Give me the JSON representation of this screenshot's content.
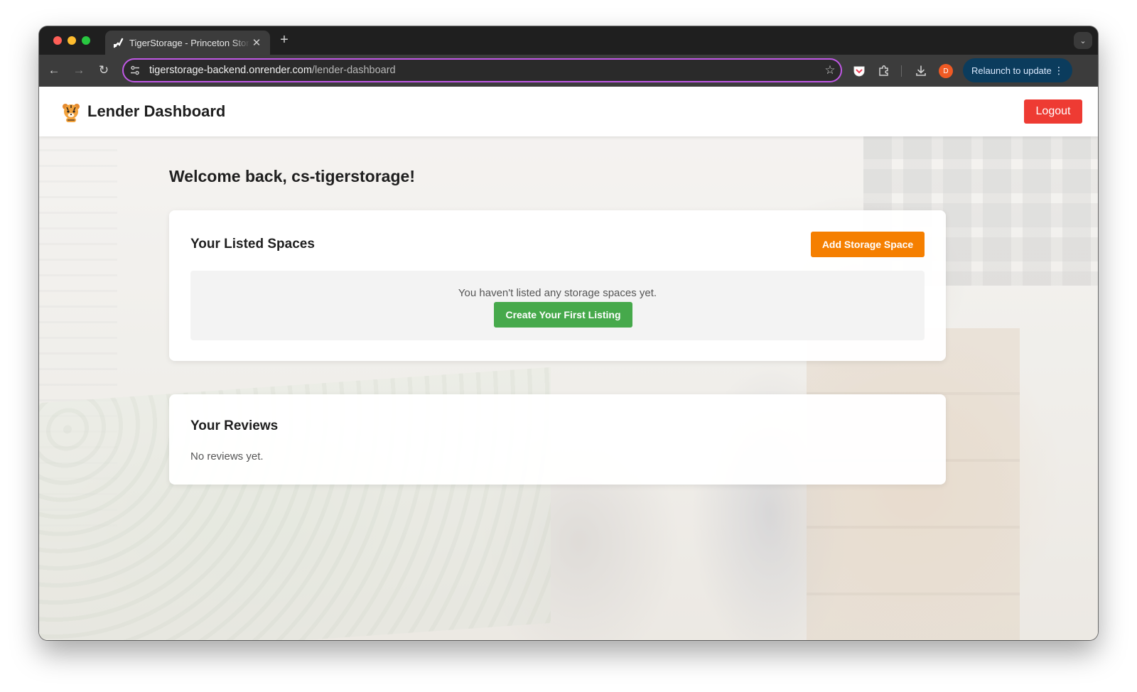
{
  "browser": {
    "tab_title": "TigerStorage - Princeton Storage",
    "url_host": "tigerstorage-backend.onrender.com",
    "url_path": "/lender-dashboard",
    "profile_initial": "D",
    "relaunch_label": "Relaunch to update",
    "new_tab": "+",
    "close_tab": "✕",
    "tab_menu": "⌄",
    "back": "←",
    "forward": "→",
    "reload": "↻",
    "star": "☆",
    "kebab": "⋮"
  },
  "header": {
    "title": "Lender Dashboard",
    "logout_label": "Logout"
  },
  "main": {
    "welcome": "Welcome back, cs-tigerstorage!",
    "spaces": {
      "title": "Your Listed Spaces",
      "add_label": "Add Storage Space",
      "empty_text": "You haven't listed any storage spaces yet.",
      "create_label": "Create Your First Listing"
    },
    "reviews": {
      "title": "Your Reviews",
      "empty_text": "No reviews yet."
    }
  },
  "colors": {
    "logout": "#ee3b33",
    "add_space": "#f57f00",
    "create_listing": "#46a94b",
    "omnibox_focus": "#c158e6",
    "relaunch_bg": "#0b3c5d"
  },
  "icons": {
    "logo": "tiger-mascot-icon",
    "site_info": "tune-icon",
    "pocket": "pocket-icon",
    "extensions": "puzzle-icon",
    "download": "download-icon"
  }
}
